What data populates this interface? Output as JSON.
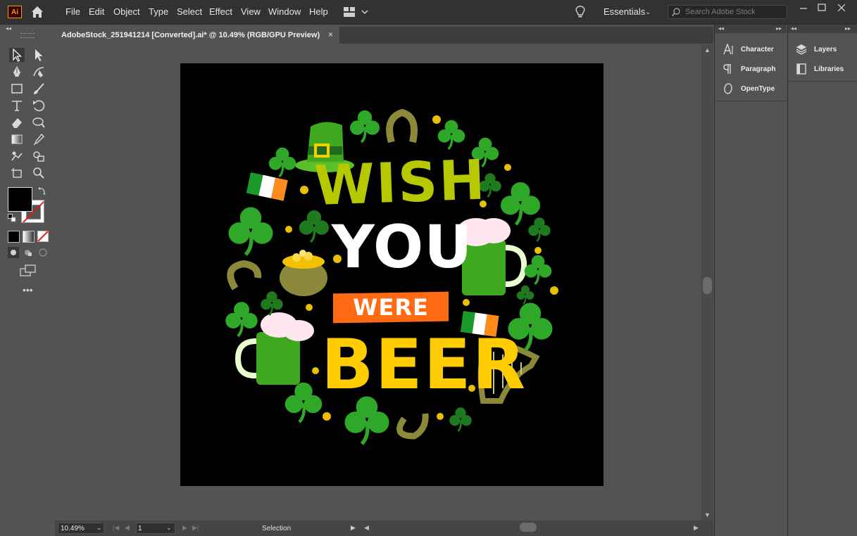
{
  "app": {
    "logo_text": "Ai",
    "menu": [
      "File",
      "Edit",
      "Object",
      "Type",
      "Select",
      "Effect",
      "View",
      "Window",
      "Help"
    ],
    "workspace": "Essentials",
    "search_placeholder": "Search Adobe Stock"
  },
  "document": {
    "tab_title": "AdobeStock_251941214 [Converted].ai* @ 10.49% (RGB/GPU Preview)",
    "close_glyph": "×"
  },
  "artwork": {
    "line1": "WISH",
    "line2": "YOU",
    "line3": "WERE",
    "line4": "BEER",
    "colors": {
      "line1": "#b5c800",
      "line2": "#ffffff",
      "line3_bg": "#ff6a13",
      "line4": "#ffcc00",
      "shamrock": "#2fa829",
      "shamrock_dark": "#1f7a1f",
      "gold": "#e8c000"
    }
  },
  "statusbar": {
    "zoom": "10.49%",
    "artboard_index": "1",
    "mode": "Selection"
  },
  "panels": {
    "left_group": [
      "Character",
      "Paragraph",
      "OpenType"
    ],
    "right_group": [
      "Layers",
      "Libraries"
    ]
  },
  "icons": {
    "tools": [
      "selection-tool-icon",
      "direct-selection-tool-icon",
      "pen-tool-icon",
      "curvature-tool-icon",
      "rectangle-tool-icon",
      "paintbrush-tool-icon",
      "type-tool-icon",
      "rotate-tool-icon",
      "eraser-tool-icon",
      "warp-tool-icon",
      "gradient-tool-icon",
      "eyedropper-tool-icon",
      "puppet-warp-tool-icon",
      "shape-builder-tool-icon",
      "artboard-tool-icon",
      "zoom-tool-icon"
    ]
  }
}
